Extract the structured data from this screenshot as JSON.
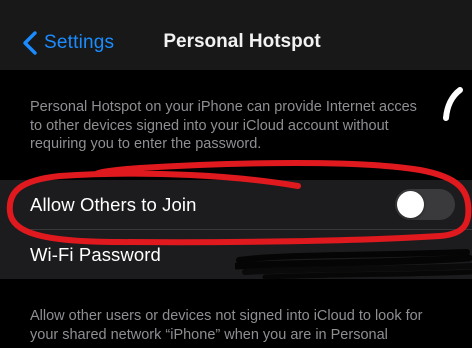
{
  "nav": {
    "back_label": "Settings",
    "title": "Personal Hotspot"
  },
  "description_top": {
    "lines": [
      "Personal Hotspot on your iPhone can provide Internet acces",
      "to other devices signed into your iCloud account without",
      "requiring you to enter the password."
    ]
  },
  "settings": {
    "allow_others": {
      "label": "Allow Others to Join",
      "enabled": false
    },
    "wifi_password": {
      "label": "Wi-Fi Password"
    }
  },
  "description_bottom": {
    "lines": [
      "Allow other users or devices not signed into iCloud to look for",
      "your shared network “iPhone” when you are in Personal"
    ]
  },
  "colors": {
    "accent": "#1a8cff",
    "annotation": "#e0191f",
    "toggle_off": "#3a3a3c"
  },
  "icons": {
    "back": "chevron-left-icon"
  }
}
